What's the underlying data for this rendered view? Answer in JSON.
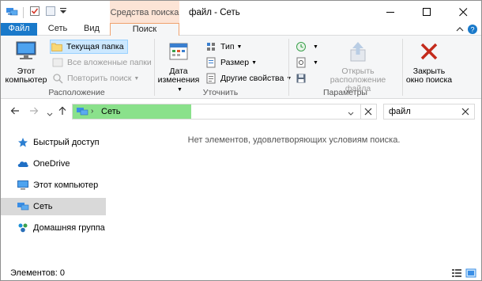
{
  "window": {
    "context_tab": "Средства поиска",
    "title": "файл - Сеть"
  },
  "tabs": {
    "file": "Файл",
    "network": "Сеть",
    "view": "Вид",
    "search": "Поиск"
  },
  "ribbon": {
    "location": {
      "this_pc": "Этот компьютер",
      "current_folder": "Текущая папка",
      "all_subfolders": "Все вложенные папки",
      "search_again": "Повторить поиск",
      "group_label": "Расположение"
    },
    "refine": {
      "date_modified": "Дата изменения",
      "kind": "Тип",
      "size": "Размер",
      "other_properties": "Другие свойства",
      "group_label": "Уточнить"
    },
    "options": {
      "open_file_location": "Открыть расположение файла",
      "group_label": "Параметры"
    },
    "close": {
      "close_search": "Закрыть окно поиска"
    }
  },
  "address": {
    "breadcrumb": "Сеть",
    "search_value": "файл"
  },
  "nav": {
    "items": [
      {
        "label": "Быстрый доступ",
        "icon": "star-icon"
      },
      {
        "label": "OneDrive",
        "icon": "cloud-icon"
      },
      {
        "label": "Этот компьютер",
        "icon": "computer-icon"
      },
      {
        "label": "Сеть",
        "icon": "network-icon"
      },
      {
        "label": "Домашняя группа",
        "icon": "homegroup-icon"
      }
    ]
  },
  "content": {
    "empty_message": "Нет элементов, удовлетворяющих условиям поиска."
  },
  "status": {
    "items_count": "Элементов: 0"
  },
  "colors": {
    "file_tab": "#1979ca",
    "context_tab": "#fce4d6",
    "search_progress": "#8ae18b",
    "close_x": "#c42b1c"
  }
}
